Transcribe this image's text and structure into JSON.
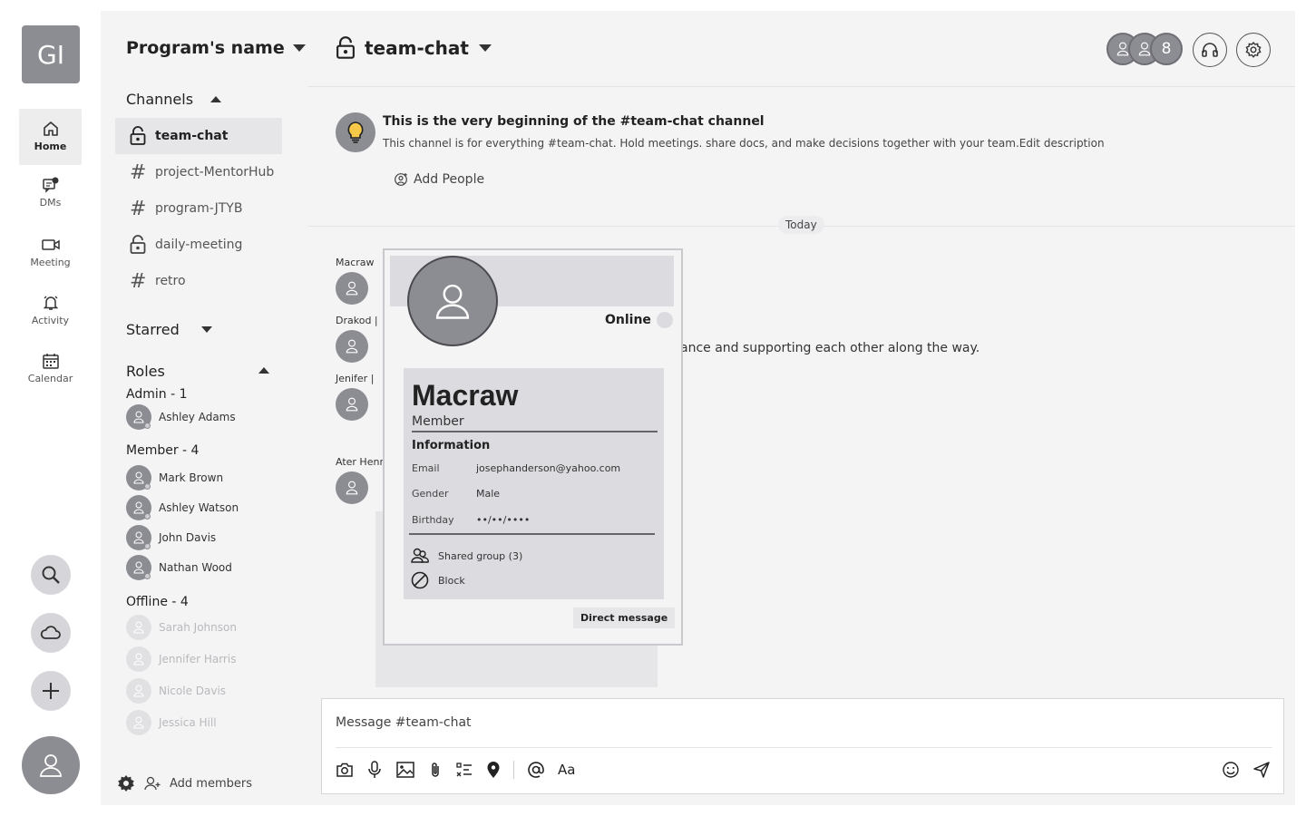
{
  "rail": {
    "logo": "GI",
    "nav": [
      {
        "label": "Home",
        "icon": "home-icon",
        "active": true
      },
      {
        "label": "DMs",
        "icon": "dm-icon"
      },
      {
        "label": "Meeting",
        "icon": "video-icon"
      },
      {
        "label": "Activity",
        "icon": "bell-icon"
      },
      {
        "label": "Calendar",
        "icon": "calendar-icon"
      }
    ]
  },
  "sidebar": {
    "program_name": "Program's name",
    "channels_title": "Channels",
    "channels": [
      {
        "name": "team-chat",
        "icon": "lock-icon",
        "active": true
      },
      {
        "name": "project-MentorHub",
        "icon": "hash-icon"
      },
      {
        "name": "program-JTYB",
        "icon": "hash-icon"
      },
      {
        "name": "daily-meeting",
        "icon": "lock-icon"
      },
      {
        "name": "retro",
        "icon": "hash-icon"
      }
    ],
    "starred_title": "Starred",
    "roles_title": "Roles",
    "admin_title": "Admin - 1",
    "admins": [
      "Ashley Adams"
    ],
    "member_title": "Member - 4",
    "members": [
      "Mark Brown",
      "Ashley Watson",
      "John Davis",
      "Nathan Wood"
    ],
    "offline_title": "Offline - 4",
    "offline": [
      "Sarah Johnson",
      "Jennifer Harris",
      "Nicole Davis",
      "Jessica Hill"
    ],
    "add_members": "Add members"
  },
  "header": {
    "channel": "team-chat",
    "member_count": "8"
  },
  "intro": {
    "title": "This is the very beginning of the #team-chat  channel",
    "desc": "This channel is for everything #team-chat. Hold meetings. share docs, and make decisions together with your team.Edit description",
    "add_people": "Add People"
  },
  "day_label": "Today",
  "messages": [
    {
      "name": "Macraw"
    },
    {
      "name": "Drakod  |"
    },
    {
      "name": "Jenifer  |  "
    },
    {
      "name": "Ater Henr"
    }
  ],
  "visible_message_text": "ance and supporting each other along the way.",
  "profile": {
    "status": "Online",
    "name": "Macraw",
    "role": "Member",
    "info_title": "Information",
    "email_label": "Email",
    "email": "josephanderson@yahoo.com",
    "gender_label": "Gender",
    "gender": "Male",
    "birthday_label": "Birthday",
    "birthday": "••/••/••••",
    "shared_group": "Shared group (3)",
    "block": "Block",
    "dm_button": "Direct message"
  },
  "composer": {
    "placeholder": "Message #team-chat",
    "format_label": "Aa"
  }
}
